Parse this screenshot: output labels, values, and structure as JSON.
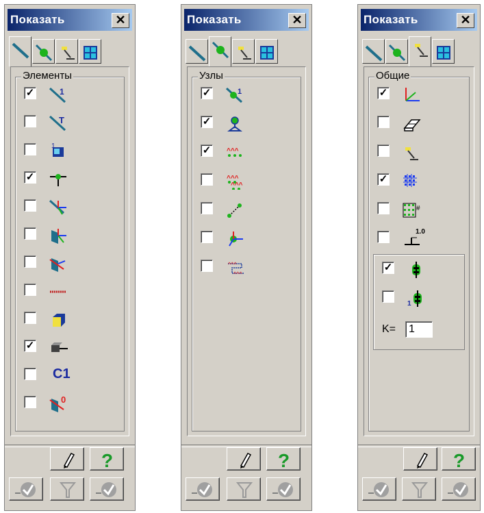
{
  "panels": [
    {
      "title": "Показать",
      "close_label": "✕",
      "group_label": "Элементы",
      "rows": [
        {
          "checked": true,
          "icon": "element-numbers-icon"
        },
        {
          "checked": false,
          "icon": "element-type-icon"
        },
        {
          "checked": false,
          "icon": "stiffness-type-icon"
        },
        {
          "checked": true,
          "icon": "hinges-icon"
        },
        {
          "checked": false,
          "icon": "local-axes-icon"
        },
        {
          "checked": false,
          "icon": "local-axes-plate-icon"
        },
        {
          "checked": false,
          "icon": "rigid-insert-icon"
        },
        {
          "checked": false,
          "icon": "fragment-line-icon"
        },
        {
          "checked": false,
          "icon": "solid-element-icon"
        },
        {
          "checked": true,
          "icon": "profile-section-icon"
        },
        {
          "checked": false,
          "icon": "construction-name-icon",
          "text": "C1"
        },
        {
          "checked": false,
          "icon": "element-load-icon"
        }
      ]
    },
    {
      "title": "Показать",
      "close_label": "✕",
      "group_label": "Узлы",
      "rows": [
        {
          "checked": true,
          "icon": "node-numbers-icon"
        },
        {
          "checked": true,
          "icon": "node-supports-icon"
        },
        {
          "checked": true,
          "icon": "node-coupled-icon"
        },
        {
          "checked": false,
          "icon": "node-unite-icon"
        },
        {
          "checked": false,
          "icon": "node-master-slave-icon"
        },
        {
          "checked": false,
          "icon": "node-local-axes-icon"
        },
        {
          "checked": false,
          "icon": "node-rigid-body-icon"
        }
      ]
    },
    {
      "title": "Показать",
      "close_label": "✕",
      "group_label": "Общие",
      "rows": [
        {
          "checked": true,
          "icon": "global-axes-icon"
        },
        {
          "checked": false,
          "icon": "eraser-icon"
        },
        {
          "checked": false,
          "icon": "lamp-icon"
        },
        {
          "checked": true,
          "icon": "grid-icon"
        },
        {
          "checked": false,
          "icon": "grid-numbers-icon"
        },
        {
          "checked": false,
          "icon": "scale-values-icon",
          "text": "1.0"
        }
      ],
      "subrows": [
        {
          "checked": true,
          "icon": "load-case-icon"
        },
        {
          "checked": false,
          "icon": "load-case-number-icon"
        }
      ],
      "k_label": "K=",
      "k_value": "1"
    }
  ],
  "colors": {
    "panel": "#d4d0c8",
    "title_start": "#0a246a",
    "title_end": "#a6caf0",
    "help": "#1a9a2a"
  }
}
